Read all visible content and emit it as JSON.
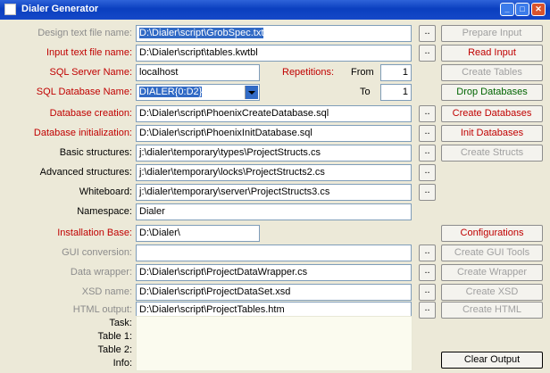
{
  "window": {
    "title": "Dialer Generator",
    "controls": {
      "minimize": "_",
      "maximize": "□",
      "close": "✕"
    }
  },
  "rows": {
    "design": {
      "label": "Design text file name:",
      "value": "D:\\Dialer\\script\\GrobSpec.txt"
    },
    "input": {
      "label": "Input text file name:",
      "value": "D:\\Dialer\\script\\tables.kwtbl"
    },
    "sqlserver": {
      "label": "SQL Server Name:",
      "value": "localhost"
    },
    "sqldb": {
      "label": "SQL Database Name:",
      "value": "DIALER{0:D2}"
    },
    "dbcreation": {
      "label": "Database creation:",
      "value": "D:\\Dialer\\script\\PhoenixCreateDatabase.sql"
    },
    "dbinit": {
      "label": "Database initialization:",
      "value": "D:\\Dialer\\script\\PhoenixInitDatabase.sql"
    },
    "basic": {
      "label": "Basic structures:",
      "value": "j:\\dialer\\temporary\\types\\ProjectStructs.cs"
    },
    "advanced": {
      "label": "Advanced structures:",
      "value": "j:\\dialer\\temporary\\locks\\ProjectStructs2.cs"
    },
    "whiteboard": {
      "label": "Whiteboard:",
      "value": "j:\\dialer\\temporary\\server\\ProjectStructs3.cs"
    },
    "namespace": {
      "label": "Namespace:",
      "value": "Dialer"
    },
    "installbase": {
      "label": "Installation Base:",
      "value": "D:\\Dialer\\"
    },
    "gui": {
      "label": "GUI conversion:",
      "value": ""
    },
    "datawrapper": {
      "label": "Data wrapper:",
      "value": "D:\\Dialer\\script\\ProjectDataWrapper.cs"
    },
    "xsd": {
      "label": "XSD name:",
      "value": "D:\\Dialer\\script\\ProjectDataSet.xsd"
    },
    "html": {
      "label": "HTML output:",
      "value": "D:\\Dialer\\script\\ProjectTables.htm"
    }
  },
  "repetitions": {
    "label": "Repetitions:",
    "from_label": "From",
    "from_value": "1",
    "to_label": "To",
    "to_value": "1"
  },
  "browse_label": "..",
  "buttons": {
    "prepare_input": "Prepare Input",
    "read_input": "Read Input",
    "create_tables": "Create Tables",
    "drop_databases": "Drop Databases",
    "create_databases": "Create Databases",
    "init_databases": "Init Databases",
    "create_structs": "Create Structs",
    "configurations": "Configurations",
    "create_gui_tools": "Create GUI Tools",
    "create_wrapper": "Create Wrapper",
    "create_xsd": "Create XSD",
    "create_html": "Create HTML",
    "clear_output": "Clear Output"
  },
  "info": {
    "task": "Task:",
    "table1": "Table 1:",
    "table2": "Table 2:",
    "info": "Info:"
  }
}
